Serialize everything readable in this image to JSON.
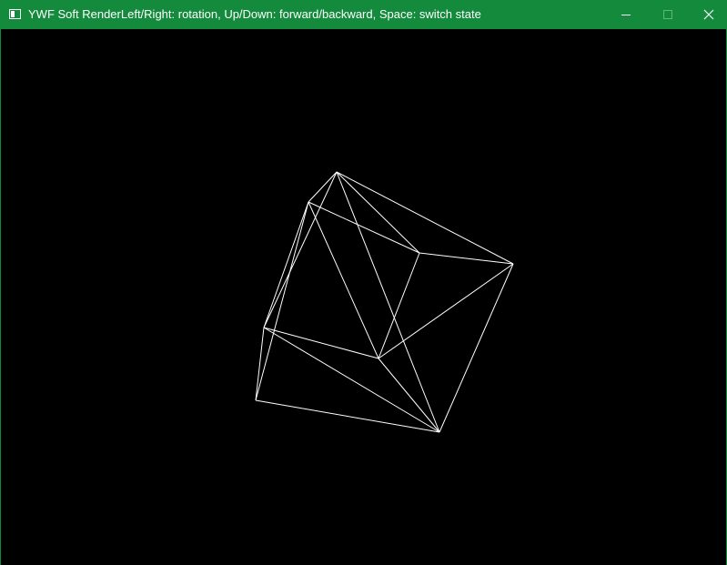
{
  "window": {
    "title": "YWF Soft RenderLeft/Right: rotation, Up/Down: forward/backward, Space: switch state",
    "icon": "app-window-icon",
    "controls": {
      "minimize_icon": "minimize-icon",
      "maximize_icon": "maximize-icon",
      "close_icon": "close-icon"
    },
    "colors": {
      "titlebar": "#138a3c",
      "background": "#000000",
      "wireframe": "#ffffff"
    }
  },
  "scene": {
    "mode": "wireframe",
    "object": "cube"
  }
}
